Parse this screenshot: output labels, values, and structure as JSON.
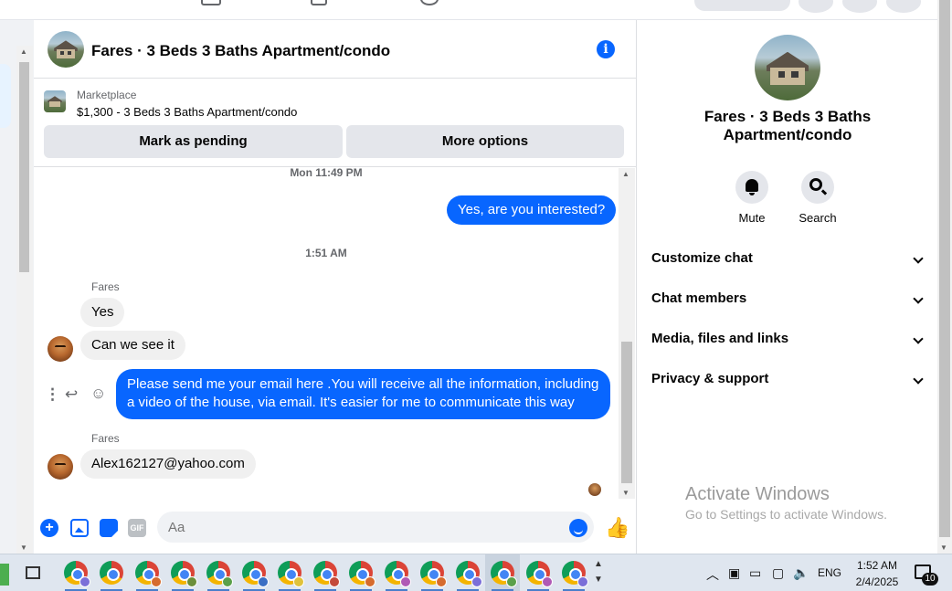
{
  "header": {
    "title": "Fares · 3 Beds 3 Baths Apartment/condo"
  },
  "listing": {
    "label": "Marketplace",
    "title": "$1,300 - 3 Beds 3 Baths Apartment/condo",
    "mark_pending": "Mark as pending",
    "more_options": "More options"
  },
  "messages": {
    "ts1": "Mon 11:49 PM",
    "out1": "Yes, are you interested?",
    "ts2": "1:51 AM",
    "sender1": "Fares",
    "in1": "Yes",
    "in2": "Can we see it",
    "out2_line1": "Please send me your email here .You will receive all the information, including",
    "out2_line2": "a video of the house, via email. It's easier for me to communicate this way",
    "sender2": "Fares",
    "in3": "Alex162127@yahoo.com"
  },
  "composer": {
    "placeholder": "Aa",
    "gif_label": "GIF"
  },
  "info_panel": {
    "name_line1": "Fares · 3 Beds 3 Baths",
    "name_line2": "Apartment/condo",
    "mute": "Mute",
    "search": "Search",
    "sections": [
      "Customize chat",
      "Chat members",
      "Media, files and links",
      "Privacy & support"
    ]
  },
  "watermark": {
    "line1": "Activate Windows",
    "line2": "Go to Settings to activate Windows."
  },
  "taskbar": {
    "lang": "ENG",
    "time": "1:52 AM",
    "date": "2/4/2025",
    "notification_count": "10"
  },
  "colors": {
    "accent": "#0866ff",
    "incoming_bubble": "#f0f0f0",
    "button_gray": "#e4e6eb"
  }
}
